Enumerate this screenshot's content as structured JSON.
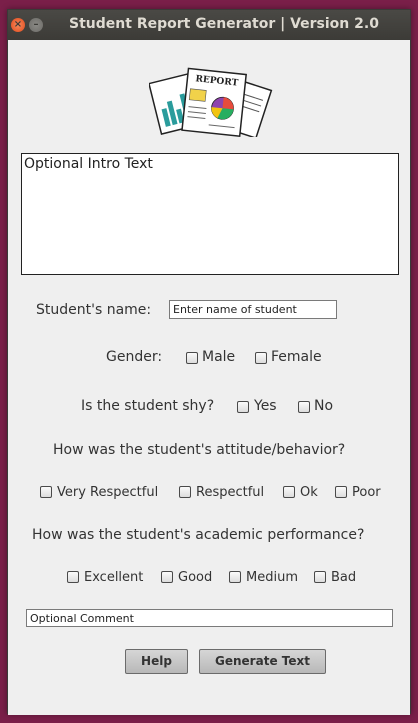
{
  "window": {
    "title": "Student Report Generator | Version 2.0",
    "close_glyph": "×",
    "minimize_glyph": "–"
  },
  "logo": {
    "icon": "report-document-icon",
    "word": "REPORT"
  },
  "intro": {
    "value": "Optional Intro Text"
  },
  "name": {
    "label": "Student's name:",
    "value": "Enter name of student"
  },
  "gender": {
    "label": "Gender:",
    "options": [
      "Male",
      "Female"
    ]
  },
  "shy": {
    "label": "Is the student shy?",
    "options": [
      "Yes",
      "No"
    ]
  },
  "attitude": {
    "question": "How was the student's attitude/behavior?",
    "options": [
      "Very Respectful",
      "Respectful",
      "Ok",
      "Poor"
    ]
  },
  "performance": {
    "question": "How was the student's academic performance?",
    "options": [
      "Excellent",
      "Good",
      "Medium",
      "Bad"
    ]
  },
  "comment": {
    "value": "Optional Comment"
  },
  "buttons": {
    "help": "Help",
    "generate": "Generate Text"
  },
  "colors": {
    "title_bar": "#3c3b37",
    "desktop": "#7a1f49",
    "close_button": "#e2491b",
    "panel": "#efefef"
  }
}
